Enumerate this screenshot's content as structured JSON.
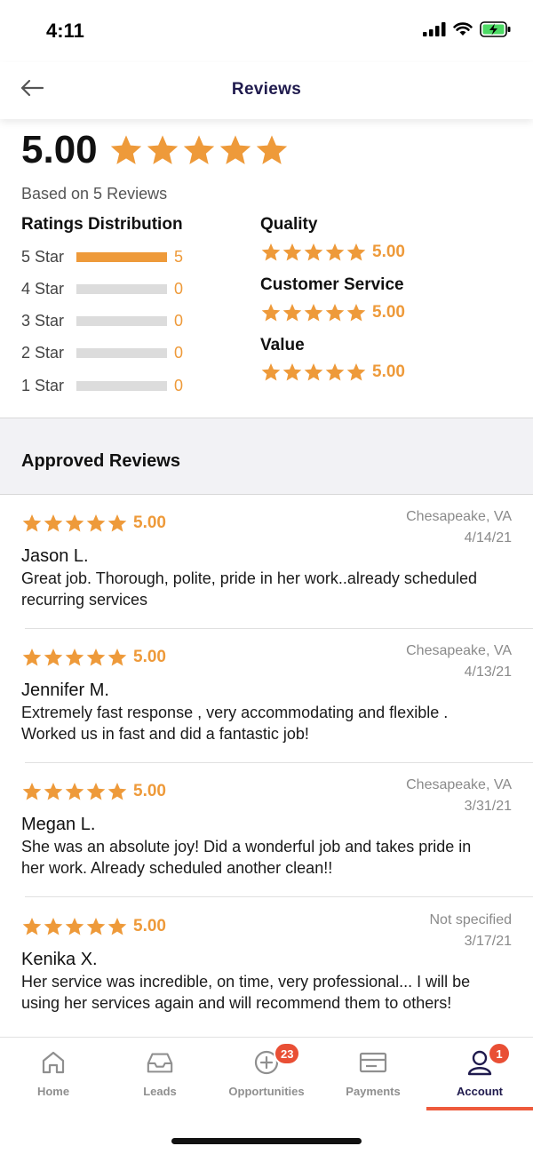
{
  "status_bar": {
    "time": "4:11"
  },
  "header": {
    "title": "Reviews"
  },
  "summary": {
    "overall_score": "5.00",
    "overall_stars": 5,
    "based_on": "Based on 5 Reviews",
    "distribution_title": "Ratings Distribution",
    "distribution": [
      {
        "label": "5 Star",
        "count": "5",
        "fraction": 1.0
      },
      {
        "label": "4 Star",
        "count": "0",
        "fraction": 0.0
      },
      {
        "label": "3 Star",
        "count": "0",
        "fraction": 0.0
      },
      {
        "label": "2 Star",
        "count": "0",
        "fraction": 0.0
      },
      {
        "label": "1 Star",
        "count": "0",
        "fraction": 0.0
      }
    ],
    "categories": [
      {
        "title": "Quality",
        "stars": 5,
        "value": "5.00"
      },
      {
        "title": "Customer Service",
        "stars": 5,
        "value": "5.00"
      },
      {
        "title": "Value",
        "stars": 5,
        "value": "5.00"
      }
    ]
  },
  "approved": {
    "title": "Approved Reviews",
    "reviews": [
      {
        "stars": 5,
        "rating": "5.00",
        "location": "Chesapeake, VA",
        "date": "4/14/21",
        "author": "Jason L.",
        "text": "Great job. Thorough, polite, pride in her work..already scheduled recurring services"
      },
      {
        "stars": 5,
        "rating": "5.00",
        "location": "Chesapeake, VA",
        "date": "4/13/21",
        "author": "Jennifer M.",
        "text": "Extremely fast response , very accommodating and flexible . Worked us in fast and did a fantastic job!"
      },
      {
        "stars": 5,
        "rating": "5.00",
        "location": "Chesapeake, VA",
        "date": "3/31/21",
        "author": "Megan L.",
        "text": "She was an absolute joy! Did a wonderful job and takes pride in her work. Already scheduled another clean!!"
      },
      {
        "stars": 5,
        "rating": "5.00",
        "location": "Not specified",
        "date": "3/17/21",
        "author": "Kenika X.",
        "text": "Her service was incredible, on time, very professional... I will be using her services again and will recommend them to others!"
      }
    ]
  },
  "tab_bar": {
    "tabs": [
      {
        "label": "Home",
        "icon": "home-icon"
      },
      {
        "label": "Leads",
        "icon": "inbox-icon"
      },
      {
        "label": "Opportunities",
        "icon": "plus-circle-icon",
        "badge": "23"
      },
      {
        "label": "Payments",
        "icon": "credit-card-icon"
      },
      {
        "label": "Account",
        "icon": "user-icon",
        "badge": "1",
        "active": true
      }
    ]
  },
  "colors": {
    "accent": "#ee9a3a",
    "navy": "#1f1a4d",
    "badge": "#e94f35",
    "bar_empty": "#dcdcdc"
  }
}
